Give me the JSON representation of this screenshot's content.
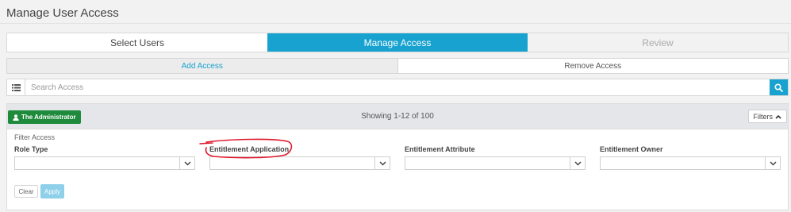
{
  "page": {
    "title": "Manage User Access"
  },
  "wizard": {
    "steps": [
      {
        "label": "Select Users"
      },
      {
        "label": "Manage Access"
      },
      {
        "label": "Review"
      }
    ]
  },
  "subtabs": [
    {
      "label": "Add Access"
    },
    {
      "label": "Remove Access"
    }
  ],
  "search": {
    "placeholder": "Search Access",
    "value": ""
  },
  "results": {
    "user_button": "The Administrator",
    "showing": "Showing 1-12 of 100",
    "filters_label": "Filters"
  },
  "filter_panel": {
    "title": "Filter Access",
    "fields": [
      {
        "label": "Role Type",
        "value": ""
      },
      {
        "label": "Entitlement Application",
        "value": ""
      },
      {
        "label": "Entitlement Attribute",
        "value": ""
      },
      {
        "label": "Entitlement Owner",
        "value": ""
      }
    ],
    "clear_label": "Clear",
    "apply_label": "Apply"
  },
  "colors": {
    "accent": "#17a2cf",
    "user_button": "#1d8a3c",
    "annotation": "#e0182c"
  }
}
